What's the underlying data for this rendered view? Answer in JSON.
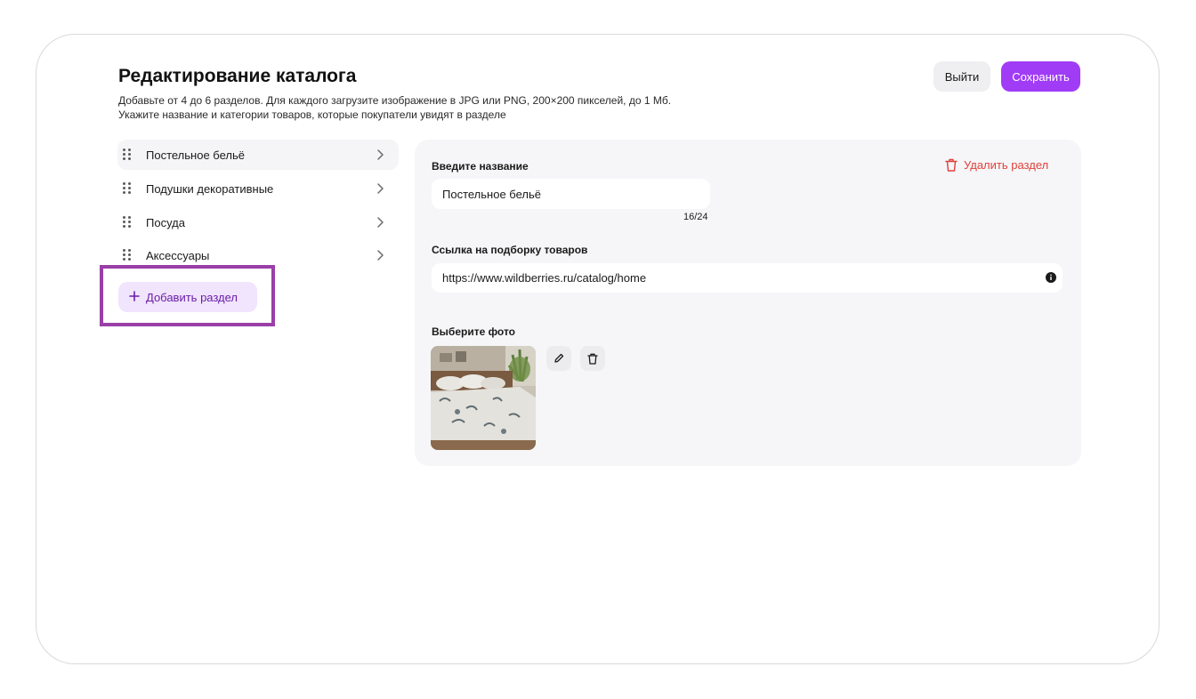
{
  "header": {
    "title": "Редактирование каталога",
    "subtitle_line1": "Добавьте от 4 до 6 разделов. Для каждого загрузите изображение в JPG или PNG, 200×200 пикселей, до 1 Мб.",
    "subtitle_line2": "Укажите название и категории товаров, которые покупатели увидят в разделе",
    "exit_label": "Выйти",
    "save_label": "Сохранить"
  },
  "sidebar": {
    "items": [
      {
        "label": "Постельное бельё",
        "active": true
      },
      {
        "label": "Подушки декоративные",
        "active": false
      },
      {
        "label": "Посуда",
        "active": false
      },
      {
        "label": "Аксессуары",
        "active": false
      }
    ],
    "add_label": "Добавить раздел"
  },
  "editor": {
    "name_label": "Введите название",
    "name_value": "Постельное бельё",
    "name_counter": "16/24",
    "delete_label": "Удалить раздел",
    "link_label": "Ссылка на подборку товаров",
    "link_value": "https://www.wildberries.ru/catalog/home",
    "photo_label": "Выберите фото"
  },
  "colors": {
    "accent": "#a13cf6",
    "accent_light": "#f1e4fd",
    "danger": "#e0413a",
    "highlight": "#9a3fa8"
  },
  "icons": {
    "drag": "drag-handle-icon",
    "chevron": "chevron-right-icon",
    "plus": "plus-icon",
    "trash": "trash-icon",
    "info": "info-icon",
    "edit": "pencil-icon"
  }
}
